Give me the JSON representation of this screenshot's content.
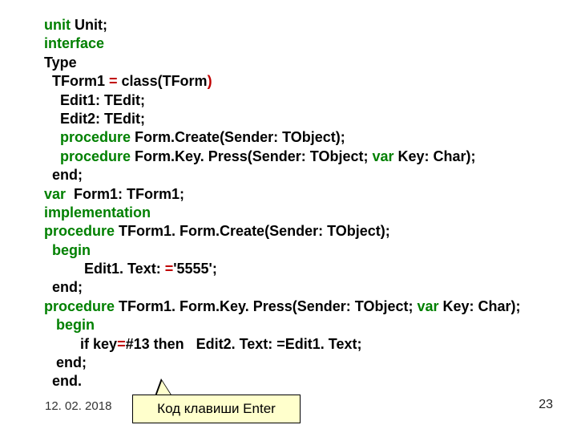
{
  "code": {
    "l1a": "unit",
    "l1b": " Unit;",
    "l2": "interface",
    "l3": "Type",
    "l4a": "  TForm1 ",
    "l4b": "=",
    "l4c": " class(TForm",
    "l4d": ")",
    "l5": "    Edit1: TEdit;",
    "l6": "    Edit2: TEdit;",
    "l7a": "    procedure",
    "l7b": " Form.Create(Sender: TObject);",
    "l8a": "    procedure",
    "l8b": " Form.Key. Press(Sender: TObject; ",
    "l8c": "var",
    "l8d": " Key: Char);",
    "l9": "  end;",
    "l10a": "var",
    "l10b": "  Form1: TForm1;",
    "l11": "implementation",
    "l12a": "procedure",
    "l12b": " TForm1. Form.Create(Sender: TObject);",
    "l13": "  begin",
    "l14a": "          Edit1. Text: ",
    "l14b": "=",
    "l14c": "'5555';",
    "l15": "  end;",
    "l16a": "procedure",
    "l16b": " TForm1. Form.Key. Press(Sender: TObject; ",
    "l16c": "var",
    "l16d": " Key: Char);",
    "l17": "   begin",
    "l18a": "         if ",
    "l18b": "key",
    "l18c": "=",
    "l18d": "#13 then   Edit2. Text: =Edit1. Text;",
    "l19": "   end;",
    "l20": "  end."
  },
  "footer": {
    "date": "12. 02. 2018",
    "page": "23"
  },
  "callout": {
    "text": "Код клавиши Enter"
  }
}
